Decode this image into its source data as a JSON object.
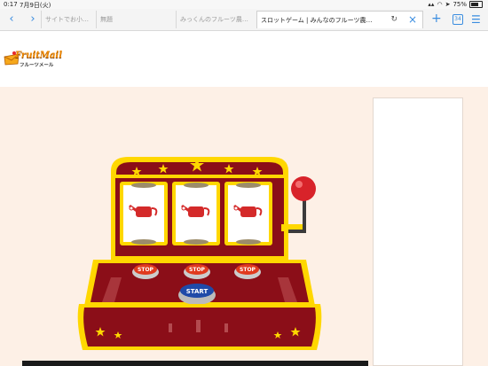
{
  "status": {
    "time": "0:17",
    "date": "7月9日(火)",
    "battery": "75%"
  },
  "tabs": [
    {
      "label": "サイトでお小…"
    },
    {
      "label": "無題"
    },
    {
      "label": "みっくんのフルーツ農…"
    },
    {
      "label": "スロットゲーム | みんなのフルーツ農…"
    }
  ],
  "tabbar": {
    "tab_count": "34"
  },
  "logo": {
    "brand": "FruitMail",
    "sub": "フルーツメール"
  },
  "slot": {
    "stop_labels": [
      "STOP",
      "STOP",
      "STOP"
    ],
    "start_label": "START",
    "colors": {
      "cabinet": "#8b0e18",
      "trim": "#ffd700",
      "stop": "#e03a1e",
      "start": "#1f4aa8",
      "lever": "#d8232a"
    }
  }
}
